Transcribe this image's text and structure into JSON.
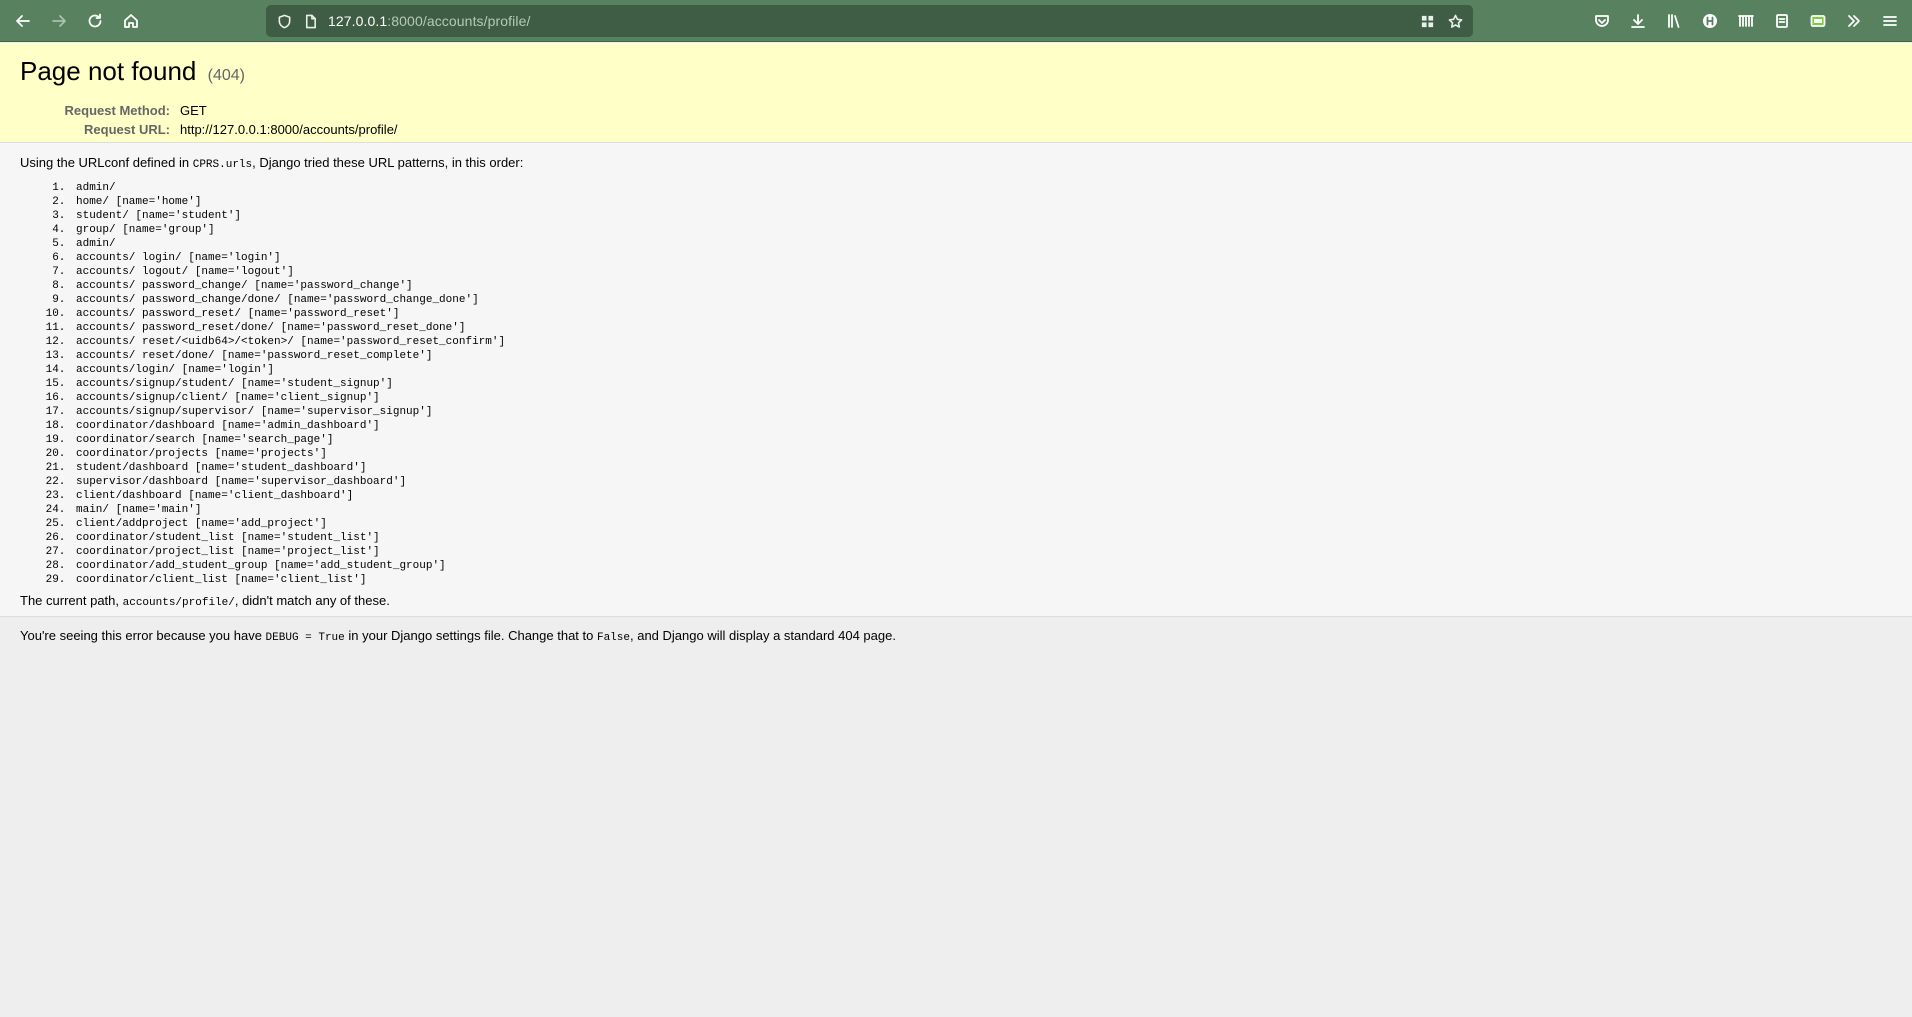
{
  "browser": {
    "url_host": "127.0.0.1",
    "url_rest": ":8000/accounts/profile/"
  },
  "summary": {
    "title": "Page not found",
    "status_code": "(404)",
    "request_method_label": "Request Method:",
    "request_method": "GET",
    "request_url_label": "Request URL:",
    "request_url": "http://127.0.0.1:8000/accounts/profile/"
  },
  "info": {
    "intro_before": "Using the URLconf defined in ",
    "urlconf": "CPRS.urls",
    "intro_after": ", Django tried these URL patterns, in this order:",
    "patterns": [
      "admin/",
      "home/ [name='home']",
      "student/ [name='student']",
      "group/ [name='group']",
      "admin/",
      "accounts/ login/ [name='login']",
      "accounts/ logout/ [name='logout']",
      "accounts/ password_change/ [name='password_change']",
      "accounts/ password_change/done/ [name='password_change_done']",
      "accounts/ password_reset/ [name='password_reset']",
      "accounts/ password_reset/done/ [name='password_reset_done']",
      "accounts/ reset/<uidb64>/<token>/ [name='password_reset_confirm']",
      "accounts/ reset/done/ [name='password_reset_complete']",
      "accounts/login/ [name='login']",
      "accounts/signup/student/ [name='student_signup']",
      "accounts/signup/client/ [name='client_signup']",
      "accounts/signup/supervisor/ [name='supervisor_signup']",
      "coordinator/dashboard [name='admin_dashboard']",
      "coordinator/search [name='search_page']",
      "coordinator/projects [name='projects']",
      "student/dashboard [name='student_dashboard']",
      "supervisor/dashboard [name='supervisor_dashboard']",
      "client/dashboard [name='client_dashboard']",
      "main/ [name='main']",
      "client/addproject [name='add_project']",
      "coordinator/student_list [name='student_list']",
      "coordinator/project_list [name='project_list']",
      "coordinator/add_student_group [name='add_student_group']",
      "coordinator/client_list [name='client_list']"
    ],
    "current_before": "The current path, ",
    "current_path": "accounts/profile/",
    "current_after": ", didn't match any of these."
  },
  "explanation": {
    "part1": "You're seeing this error because you have ",
    "debug_code": "DEBUG = True",
    "part2": " in your Django settings file. Change that to ",
    "false_code": "False",
    "part3": ", and Django will display a standard 404 page."
  }
}
